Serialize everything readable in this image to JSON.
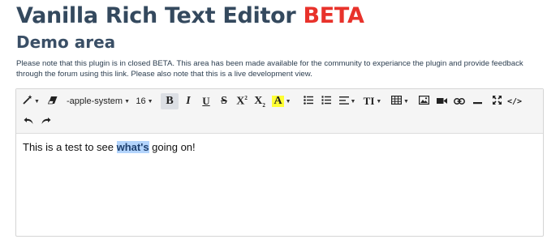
{
  "header": {
    "title_main": "Vanilla Rich Text Editor",
    "title_beta": "BETA",
    "subtitle": "Demo area",
    "notice": "Please note that this plugin is in closed BETA.  This area has been made available for the community to experiance the plugin and provide feedback through the forum using this link.  Please also note that this is a live development view."
  },
  "toolbar": {
    "font_name": "-apple-system",
    "font_size": "16",
    "bold": "B",
    "italic": "I",
    "underline": "U",
    "strikethrough": "S",
    "superscript": "X",
    "superscript_mark": "2",
    "subscript": "X",
    "subscript_mark": "2",
    "font_color": "A",
    "text_size": "TI",
    "code": "</>"
  },
  "editor": {
    "text_before": "This is a test to see ",
    "text_selected": "what's",
    "text_after": " going on!"
  },
  "colors": {
    "title": "#34495e",
    "beta": "#e8322b",
    "selection": "#b3d4fc"
  }
}
